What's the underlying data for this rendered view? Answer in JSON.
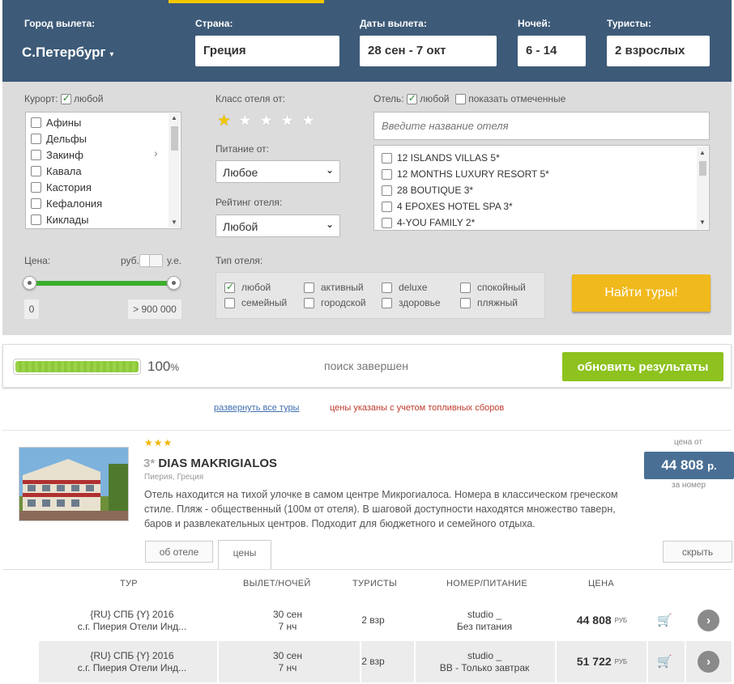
{
  "header": {
    "city_label": "Город вылета:",
    "city_value": "С.Петербург",
    "country_label": "Страна:",
    "country_value": "Греция",
    "dates_label": "Даты вылета:",
    "dates_value": "28 сен - 7 окт",
    "nights_label": "Ночей:",
    "nights_value": "6 - 14",
    "tourists_label": "Туристы:",
    "tourists_value": "2 взрослых"
  },
  "filters": {
    "resort_label": "Курорт:",
    "resort_any": "любой",
    "resorts": [
      "Афины",
      "Дельфы",
      "Закинф",
      "Кавала",
      "Кастория",
      "Кефалония",
      "Киклады"
    ],
    "hotel_class_label": "Класс отеля от:",
    "hotel_class_stars": 1,
    "meal_label": "Питание от:",
    "meal_value": "Любое",
    "rating_label": "Рейтинг отеля:",
    "rating_value": "Любой",
    "hotel_label": "Отель:",
    "hotel_any": "любой",
    "show_marked": "показать отмеченные",
    "hotel_search_placeholder": "Введите название отеля",
    "hotels": [
      "12 ISLANDS VILLAS 5*",
      "12 MONTHS LUXURY RESORT 5*",
      "28 BOUTIQUE 3*",
      "4 EPOXES HOTEL SPA 3*",
      "4-YOU FAMILY 2*"
    ],
    "price_label": "Цена:",
    "currency_rub": "руб.",
    "currency_ue": "у.е.",
    "price_min": "0",
    "price_max": "> 900 000",
    "hotel_type_label": "Тип отеля:",
    "hotel_types": [
      {
        "label": "любой",
        "checked": true
      },
      {
        "label": "активный",
        "checked": false
      },
      {
        "label": "deluxe",
        "checked": false
      },
      {
        "label": "спокойный",
        "checked": false
      },
      {
        "label": "семейный",
        "checked": false
      },
      {
        "label": "городской",
        "checked": false
      },
      {
        "label": "здоровье",
        "checked": false
      },
      {
        "label": "пляжный",
        "checked": false
      }
    ],
    "find_button": "Найти туры!"
  },
  "progress": {
    "percent_value": "100",
    "percent_sign": "%",
    "fraction": 1.0,
    "status": "поиск завершен",
    "refresh_button": "обновить результаты"
  },
  "links": {
    "expand_all": "развернуть все туры",
    "fuel_note": "цены указаны с учетом топливных сборов"
  },
  "hotel": {
    "stars": 3,
    "star_prefix": "3*",
    "name": "DIAS MAKRIGIALOS",
    "location": "Пиерия, Греция",
    "description": "Отель находится на тихой улочке в самом центре Микрогиалоса. Номера в классическом греческом стиле. Пляж - общественный (100м от отеля). В шаговой доступности находятся множество таверн, баров и развлекательных центров. Подходит для бюджетного и семейного отдыха.",
    "price_from_label": "цена от",
    "price_value": "44 808",
    "price_currency": "р.",
    "per_room": "за номер",
    "tab_about": "об отеле",
    "tab_prices": "цены",
    "hide_button": "скрыть"
  },
  "table": {
    "headers": [
      "ТУР",
      "ВЫЛЕТ/НОЧЕЙ",
      "ТУРИСТЫ",
      "НОМЕР/ПИТАНИЕ",
      "ЦЕНА"
    ],
    "rows": [
      {
        "tour1": "{RU} СПБ {Y} 2016",
        "tour2": "с.г. Пиерия Отели Инд...",
        "date": "30 сен",
        "nights": "7 нч",
        "tourists": "2 взр",
        "room": "studio _",
        "meal": "Без питания",
        "price": "44 808",
        "cur": "РУБ"
      },
      {
        "tour1": "{RU} СПБ {Y} 2016",
        "tour2": "с.г. Пиерия Отели Инд...",
        "date": "30 сен",
        "nights": "7 нч",
        "tourists": "2 взр",
        "room": "studio _",
        "meal": "BB - Только завтрак",
        "price": "51 722",
        "cur": "РУБ"
      }
    ]
  },
  "colors": {
    "header_bg": "#3d5a78",
    "accent": "#f2c700",
    "find_button": "#f0b91c",
    "refresh_button": "#8dc21f",
    "price_box": "#4a6f94"
  }
}
